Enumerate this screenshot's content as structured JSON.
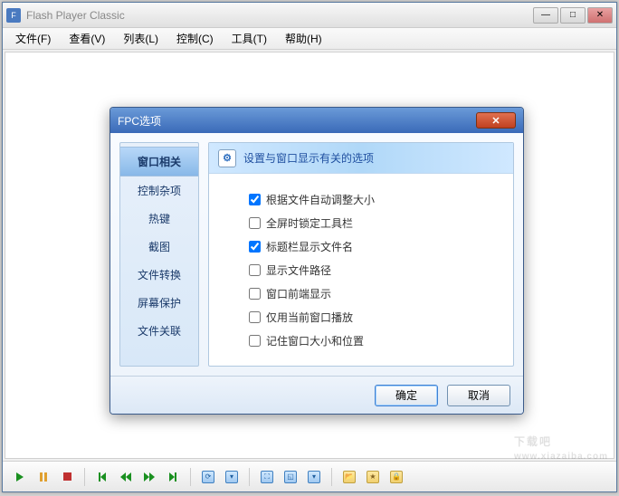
{
  "window": {
    "title": "Flash Player Classic",
    "controls": {
      "min": "—",
      "max": "□",
      "close": "✕"
    }
  },
  "menu": {
    "file": "文件(F)",
    "view": "查看(V)",
    "list": "列表(L)",
    "control": "控制(C)",
    "tools": "工具(T)",
    "help": "帮助(H)"
  },
  "dialog": {
    "title": "FPC选项",
    "header_text": "设置与窗口显示有关的选项",
    "nav": [
      "窗口相关",
      "控制杂项",
      "热键",
      "截图",
      "文件转换",
      "屏幕保护",
      "文件关联"
    ],
    "options": [
      {
        "label": "根据文件自动调整大小",
        "checked": true
      },
      {
        "label": "全屏时锁定工具栏",
        "checked": false
      },
      {
        "label": "标题栏显示文件名",
        "checked": true
      },
      {
        "label": "显示文件路径",
        "checked": false
      },
      {
        "label": "窗口前端显示",
        "checked": false
      },
      {
        "label": "仅用当前窗口播放",
        "checked": false
      },
      {
        "label": "记住窗口大小和位置",
        "checked": false
      }
    ],
    "buttons": {
      "ok": "确定",
      "cancel": "取消"
    }
  },
  "watermark": {
    "main": "下载吧",
    "sub": "www.xiazaiba.com"
  }
}
